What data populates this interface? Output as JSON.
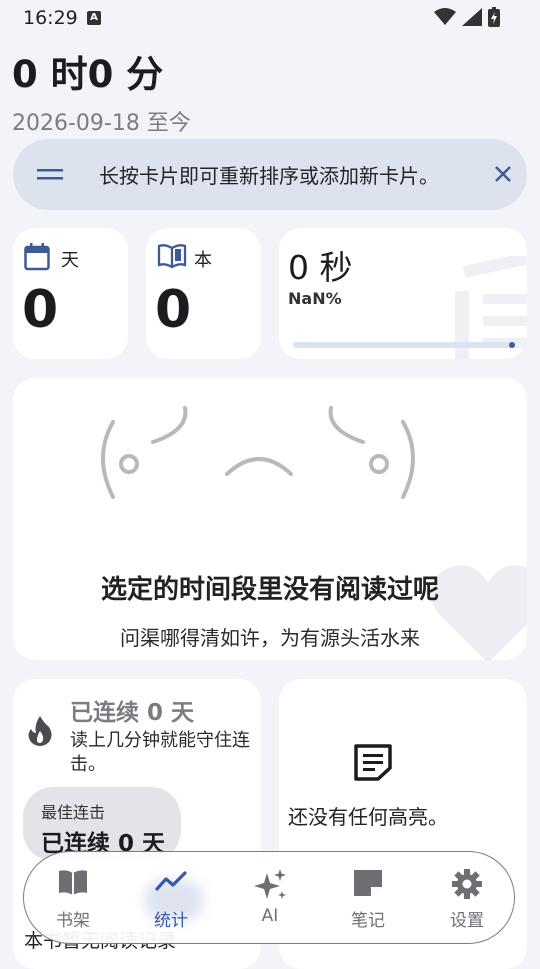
{
  "status": {
    "time": "16:29",
    "notif_letter": "A"
  },
  "header": {
    "total_time": "0 时0 分",
    "date_range": "2026-09-18 至今"
  },
  "tip": {
    "text": "长按卡片即可重新排序或添加新卡片。"
  },
  "stats": {
    "days_unit": "天",
    "days_value": "0",
    "books_unit": "本",
    "books_value": "0",
    "time_value": "0 秒",
    "time_percent": "NaN%",
    "time_progress": 1.0
  },
  "empty": {
    "kaomoji_left": "(",
    "kaomoji_right": ")",
    "title": "选定的时间段里没有阅读过呢",
    "subtitle": "问渠哪得清如许，为有源头活水来"
  },
  "streak": {
    "title": "已连续 0 天",
    "desc": "读上几分钟就能守住连击。",
    "best_label": "最佳连击",
    "best_value": "已连续 0 天"
  },
  "highlights": {
    "empty_text": "还没有任何高亮。"
  },
  "nav": [
    {
      "icon": "book-icon",
      "label": "书架"
    },
    {
      "icon": "trend-icon",
      "label": "统计",
      "active": true
    },
    {
      "icon": "sparkle-icon",
      "label": "AI"
    },
    {
      "icon": "note-icon",
      "label": "笔记"
    },
    {
      "icon": "gear-icon",
      "label": "设置"
    }
  ],
  "footer": {
    "partial_text": "本书暂无阅读记录"
  },
  "colors": {
    "accent": "#3658a8",
    "card": "#ffffff",
    "background": "#f3f4f9",
    "tip_bg": "#dce3ef"
  }
}
